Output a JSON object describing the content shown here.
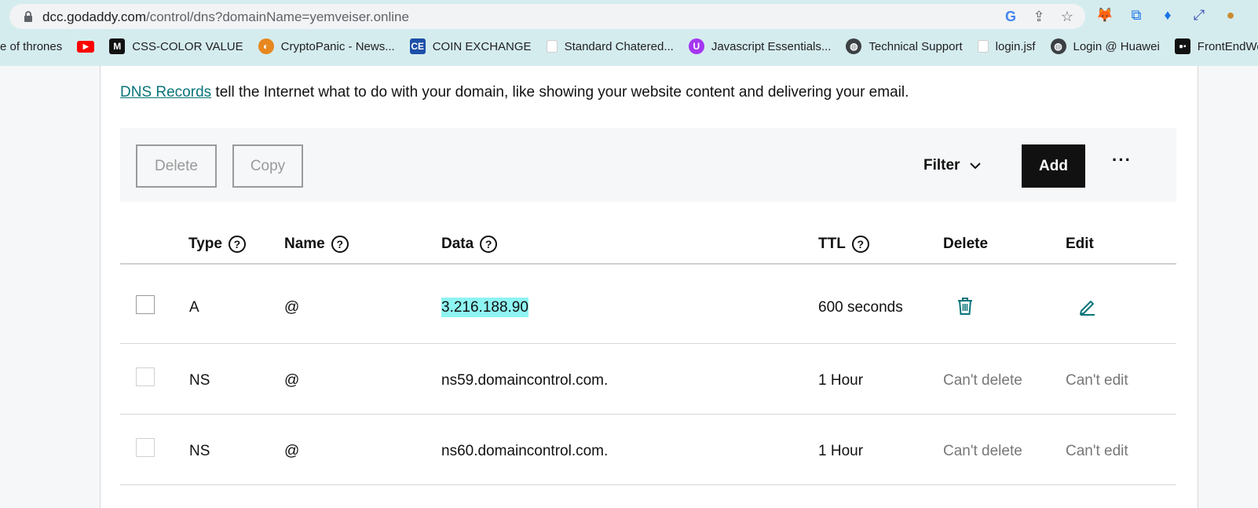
{
  "browser": {
    "url_domain": "dcc.godaddy.com",
    "url_path": "/control/dns?domainName=yemveiser.online",
    "bookmarks": [
      {
        "label": "e of thrones"
      },
      {
        "label": ""
      },
      {
        "label": "CSS-COLOR VALUE"
      },
      {
        "label": "CryptoPanic - News..."
      },
      {
        "label": "COIN EXCHANGE",
        "badge": "CE"
      },
      {
        "label": "Standard Chatered..."
      },
      {
        "label": "Javascript Essentials..."
      },
      {
        "label": "Technical Support"
      },
      {
        "label": "login.jsf"
      },
      {
        "label": "Login @ Huawei"
      },
      {
        "label": "FrontEndWebD"
      }
    ]
  },
  "intro": {
    "link": "DNS Records",
    "text": " tell the Internet what to do with your domain, like showing your website content and delivering your email."
  },
  "toolbar": {
    "delete_label": "Delete",
    "copy_label": "Copy",
    "filter_label": "Filter",
    "add_label": "Add",
    "more_label": "···"
  },
  "table": {
    "headers": {
      "type": "Type",
      "name": "Name",
      "data": "Data",
      "ttl": "TTL",
      "delete": "Delete",
      "edit": "Edit"
    },
    "help_glyph": "?",
    "rows": [
      {
        "type": "A",
        "name": "@",
        "data": "3.216.188.90",
        "ttl": "600 seconds",
        "delete": "",
        "edit": ""
      },
      {
        "type": "NS",
        "name": "@",
        "data": "ns59.domaincontrol.com.",
        "ttl": "1 Hour",
        "delete": "Can't delete",
        "edit": "Can't edit"
      },
      {
        "type": "NS",
        "name": "@",
        "data": "ns60.domaincontrol.com.",
        "ttl": "1 Hour",
        "delete": "Can't delete",
        "edit": "Can't edit"
      }
    ]
  },
  "colors": {
    "accent": "#09757a",
    "highlight": "#8ef4f2",
    "chrome": "#d5ecee"
  }
}
